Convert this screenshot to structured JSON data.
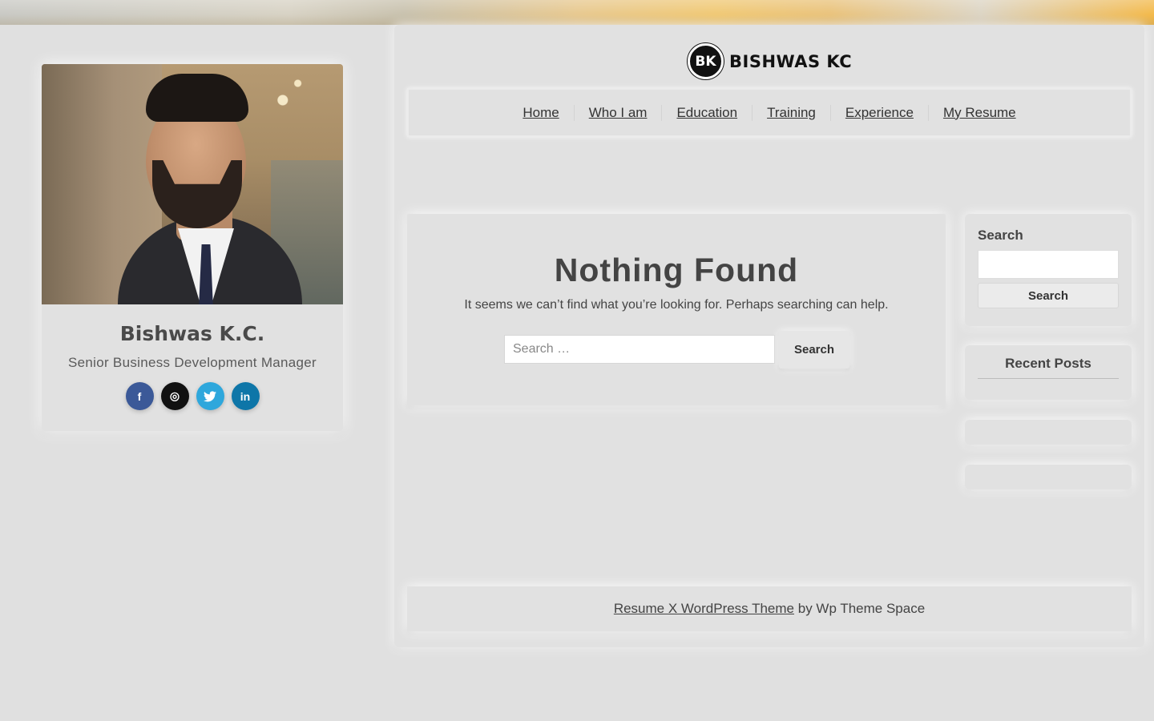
{
  "profile": {
    "name": "Bishwas K.C.",
    "title": "Senior Business Development Manager",
    "social": [
      {
        "icon": "facebook-icon",
        "glyph": "f",
        "color": "#3b5998"
      },
      {
        "icon": "instagram-icon",
        "glyph": "◎",
        "color": "#111111"
      },
      {
        "icon": "twitter-icon",
        "glyph": "🐦",
        "color": "#2ea7dc"
      },
      {
        "icon": "linkedin-icon",
        "glyph": "in",
        "color": "#0e76a8"
      }
    ]
  },
  "header": {
    "logo_mark": "BK",
    "logo_text": "BISHWAS KC"
  },
  "nav": {
    "items": [
      {
        "label": "Home"
      },
      {
        "label": "Who I am"
      },
      {
        "label": "Education"
      },
      {
        "label": "Training"
      },
      {
        "label": "Experience"
      },
      {
        "label": "My Resume"
      }
    ]
  },
  "content": {
    "title": "Nothing Found",
    "text": "It seems we can’t find what you’re looking for. Perhaps searching can help.",
    "search_placeholder": "Search …",
    "search_button": "Search"
  },
  "sidebar": {
    "search_label": "Search",
    "search_button": "Search",
    "recent_posts_title": "Recent Posts"
  },
  "footer": {
    "link_text": "Resume X WordPress Theme",
    "suffix": " by Wp Theme Space"
  }
}
